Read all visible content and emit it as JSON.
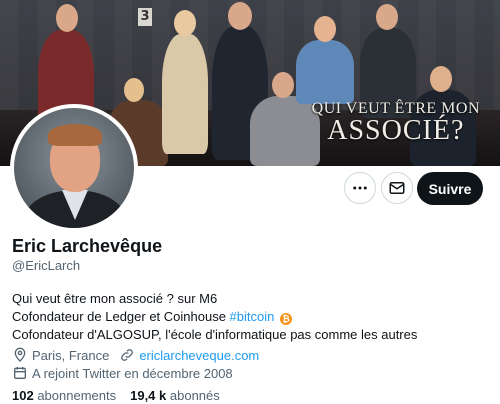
{
  "banner": {
    "wall_number": "3",
    "show_title_line1": "QUI VEUT ÊTRE MON",
    "show_title_line2": "ASSOCIÉ?"
  },
  "actions": {
    "more_icon": "more-horizontal-icon",
    "mail_icon": "mail-icon",
    "follow_label": "Suivre"
  },
  "profile": {
    "name": "Eric Larchevêque",
    "handle": "@EricLarch",
    "bio": {
      "line1": "Qui veut être mon associé ? sur M6",
      "line2_prefix": "Cofondateur de Ledger et Coinhouse ",
      "line2_hashtag": "#bitcoin",
      "line2_emoji": "₿",
      "line3": "Cofondateur d'ALGOSUP, l'école d'informatique pas comme les autres"
    },
    "location": "Paris, France",
    "website": "ericlarcheveque.com",
    "joined": "A rejoint Twitter en décembre 2008"
  },
  "stats": {
    "following_count": "102",
    "following_label": "abonnements",
    "followers_count": "19,4 k",
    "followers_label": "abonnés"
  },
  "colors": {
    "accent": "#1d9bf0",
    "text": "#0f1419",
    "secondary_text": "#536471",
    "follow_bg": "#0f1419",
    "bitcoin": "#f7931a"
  }
}
